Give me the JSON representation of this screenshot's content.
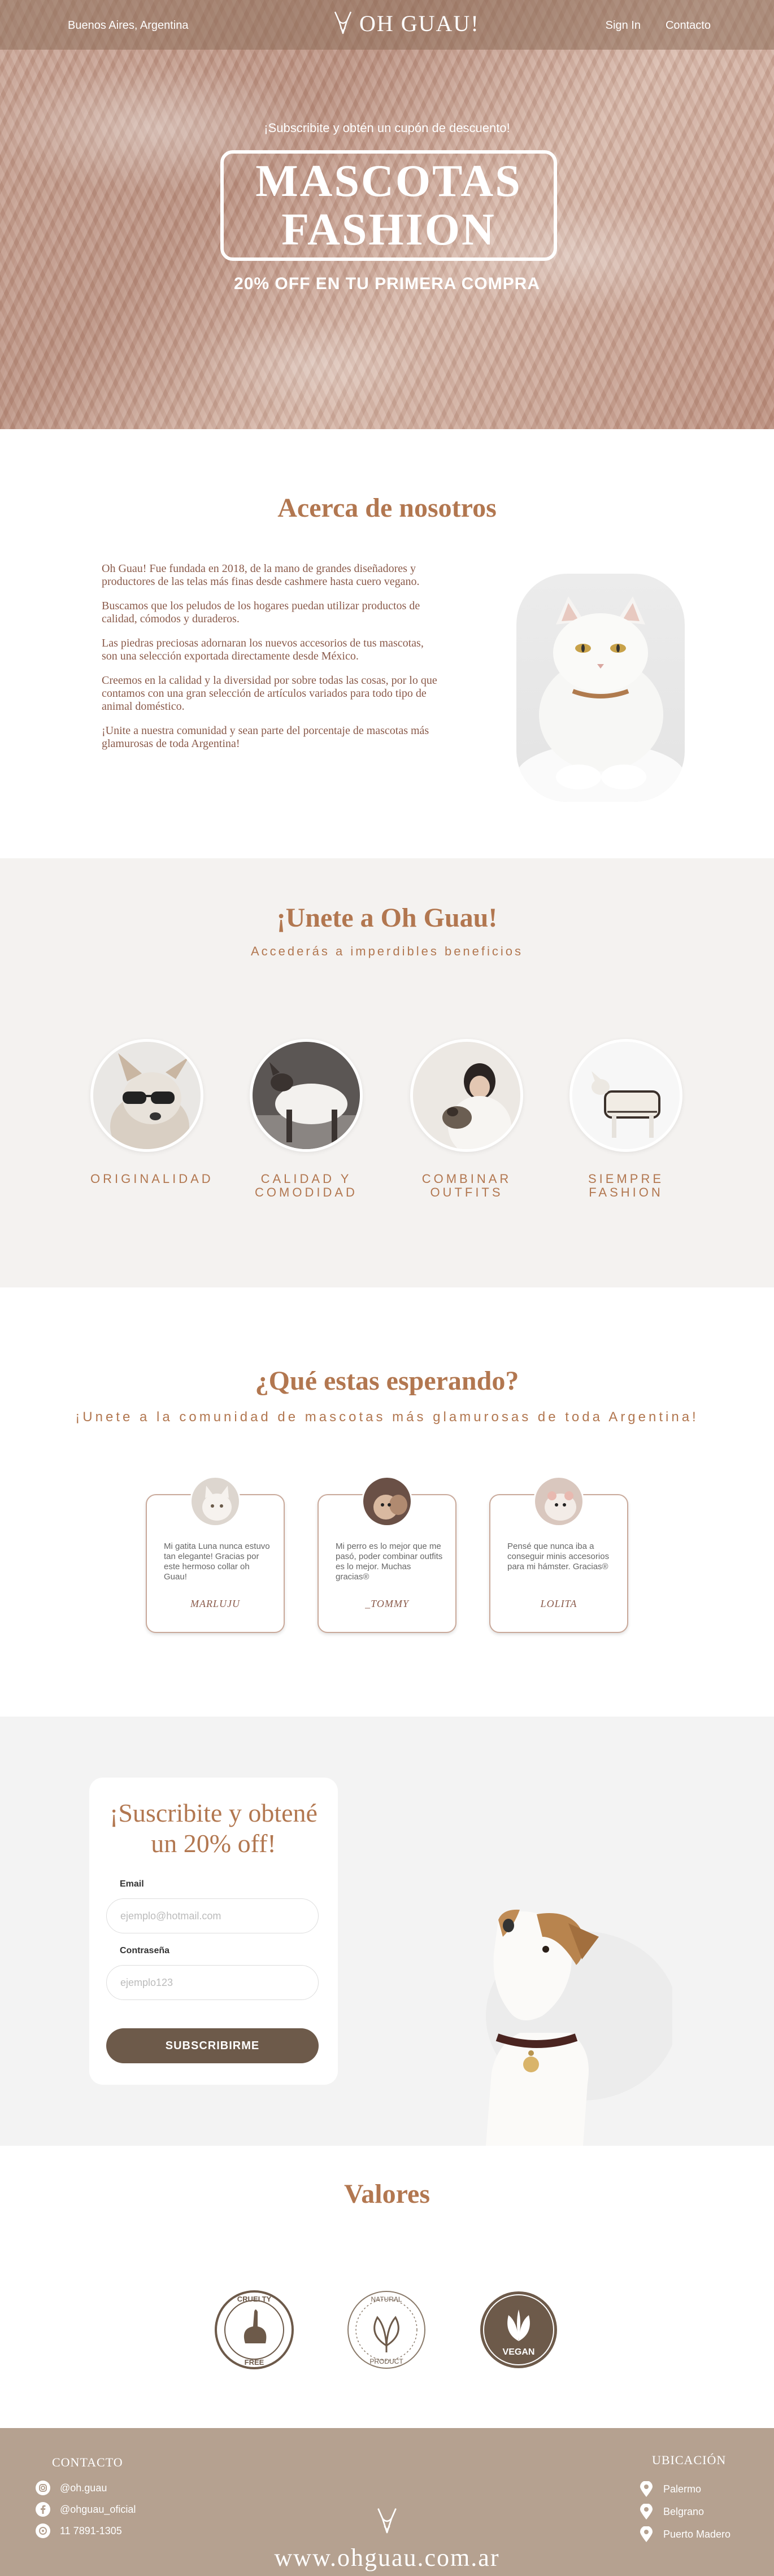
{
  "header": {
    "location": "Buenos Aires, Argentina",
    "brand": "OH GUAU!",
    "links": [
      "Sign In",
      "Contacto"
    ]
  },
  "hero": {
    "promo": "¡Subscribite y obtén un cupón de descuento!",
    "title_line1": "MASCOTAS",
    "title_line2": "FASHION",
    "offer": "20% OFF EN TU PRIMERA COMPRA"
  },
  "about": {
    "title": "Acerca de nosotros",
    "paragraphs": [
      "Oh Guau! Fue fundada en 2018, de la mano de grandes diseñadores y productores de las telas más finas desde cashmere hasta cuero vegano.",
      "Buscamos que los peludos de los hogares puedan utilizar productos de calidad, cómodos y duraderos.",
      "Las piedras preciosas adornaran los nuevos accesorios de tus mascotas, son una selección exportada directamente desde México.",
      "Creemos en la calidad y la diversidad por sobre todas las cosas, por lo que contamos con una gran selección de artículos variados para todo tipo de animal doméstico.",
      "¡Unite a nuestra comunidad y sean parte del porcentaje de mascotas más glamurosas de toda Argentina!"
    ]
  },
  "join": {
    "title": "¡Unete a Oh Guau!",
    "subtitle": "Accederás a imperdibles beneficios",
    "benefits": [
      {
        "line1": "ORIGINALIDAD",
        "line2": ""
      },
      {
        "line1": "CALIDAD Y",
        "line2": "COMODIDAD"
      },
      {
        "line1": "COMBINAR",
        "line2": "OUTFITS"
      },
      {
        "line1": "SIEMPRE",
        "line2": "FASHION"
      }
    ]
  },
  "waiting": {
    "title": "¿Qué estas esperando?",
    "subtitle": "¡Unete a la comunidad de mascotas más glamurosas de toda Argentina!",
    "testimonials": [
      {
        "text": "Mi gatita Luna nunca estuvo tan elegante! Gracias por este hermoso collar oh Guau!",
        "name": "MARLUJU"
      },
      {
        "text": "Mi perro es lo mejor que me pasó, poder combinar outfits es lo mejor. Muchas gracias®",
        "name": "_TOMMY"
      },
      {
        "text": "Pensé que nunca iba a conseguir minis accesorios para mi hámster. Gracias®",
        "name": "LOLITA"
      }
    ]
  },
  "subscribe": {
    "title_line1": "¡Suscribite y obtené",
    "title_line2": "un 20% off!",
    "email_label": "Email",
    "email_placeholder": "ejemplo@hotmail.com",
    "password_label": "Contraseña",
    "password_placeholder": "ejemplo123",
    "button": "SUBSCRIBIRME"
  },
  "values": {
    "title": "Valores",
    "badges": [
      {
        "top": "CRUELTY",
        "bottom": "FREE",
        "icon": "rabbit-icon"
      },
      {
        "top": "NATURAL",
        "bottom": "PRODUCT",
        "icon": "leaf-icon"
      },
      {
        "top": "",
        "bottom": "VEGAN",
        "icon": "vegan-leaf-icon"
      }
    ]
  },
  "footer": {
    "contact_title": "CONTACTO",
    "contacts": [
      "@oh.guau",
      "@ohguau_oficial",
      "11 7891-1305"
    ],
    "location_title": "UBICACIÓN",
    "locations": [
      "Palermo",
      "Belgrano",
      "Puerto Madero"
    ],
    "website": "www.ohguau.com.ar"
  },
  "colors": {
    "accent": "#b27750",
    "footer_bg": "#b5a190",
    "button_bg": "#6d5a4a",
    "section_alt": "#f4f2f0"
  }
}
